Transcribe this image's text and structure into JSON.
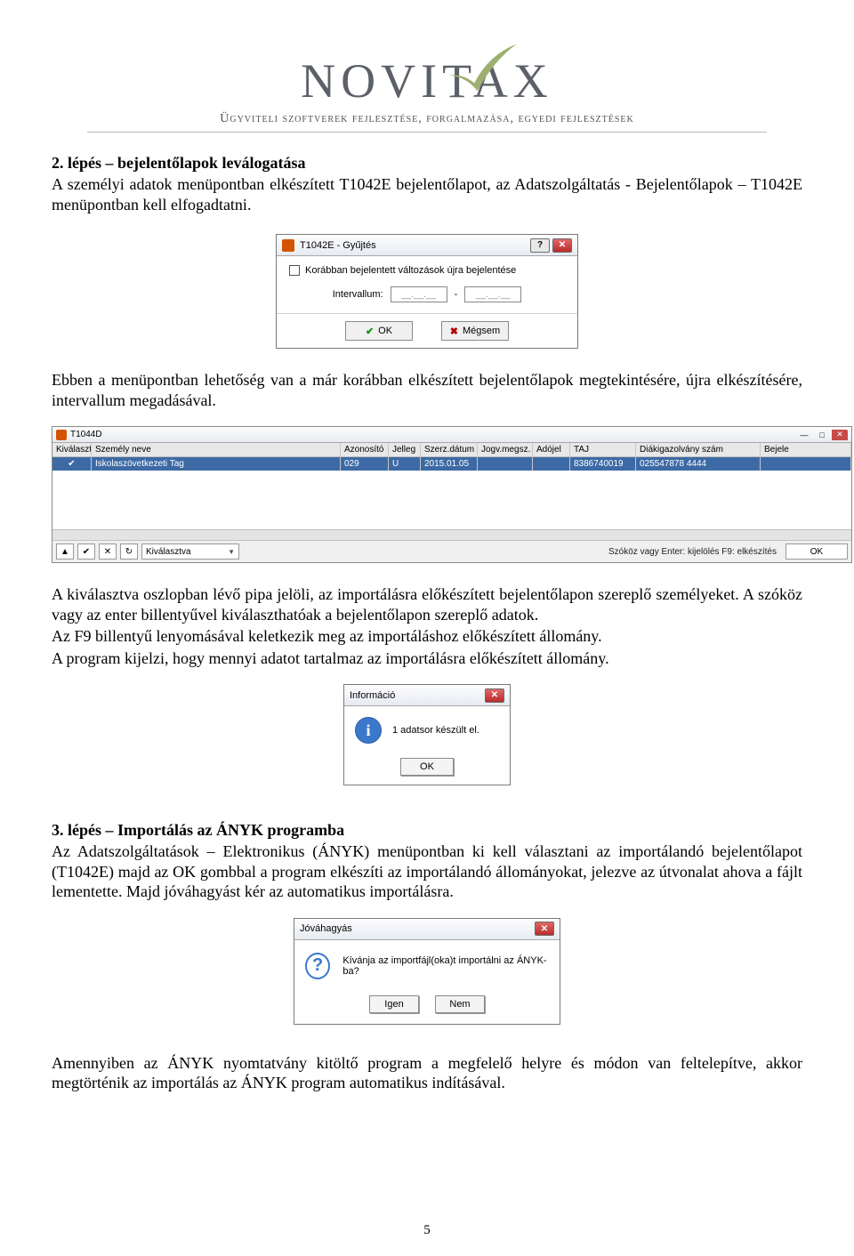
{
  "brand": {
    "name": "NOVITAX",
    "tagline": "Ügyviteli szoftverek fejlesztése, forgalmazása, egyedi fejlesztések"
  },
  "step2": {
    "heading": "2. lépés – bejelentőlapok leválogatása",
    "p1": "A személyi adatok menüpontban elkészített T1042E bejelentőlapot, az Adatszolgáltatás - Bejelentőlapok – T1042E menüpontban kell elfogadtatni.",
    "p2": "Ebben a menüpontban lehetőség van a már korábban elkészített bejelentőlapok megtekintésére, újra elkészítésére, intervallum megadásával.",
    "p3": "A kiválasztva oszlopban lévő pipa jelöli, az importálásra előkészített bejelentőlapon szereplő személyeket. A szóköz vagy az enter billentyűvel kiválaszthatóak a bejelentőlapon szereplő adatok.",
    "p4": "Az F9 billentyű lenyomásával keletkezik meg az importáláshoz előkészített állomány.",
    "p5": "A program kijelzi, hogy mennyi adatot tartalmaz az importálásra előkészített állomány."
  },
  "dlg1": {
    "title": "T1042E - Gyűjtés",
    "checkbox_label": "Korábban bejelentett változások újra bejelentése",
    "interval_label": "Intervallum:",
    "date_placeholder": "__.__.__",
    "ok": "OK",
    "cancel": "Mégsem"
  },
  "table": {
    "title": "T1044D",
    "headers": {
      "kivalasztva": "Kiválasztva",
      "szemely_neve": "Személy neve",
      "azonosito": "Azonosító",
      "jelleg": "Jelleg",
      "szerz_datum": "Szerz.dátum",
      "jogv_megsz": "Jogv.megsz.",
      "adojel": "Adójel",
      "taj": "TAJ",
      "diakigazolvany": "Diákigazolvány szám",
      "bejele": "Bejele"
    },
    "row": {
      "szemely_neve": "Iskolaszövetkezeti Tag",
      "azonosito": "029",
      "jelleg": "U",
      "szerz_datum": "2015.01.05",
      "jogv_megsz": "",
      "adojel": "",
      "taj": "8386740019",
      "diakigazolvany": "025547878  4444",
      "bejele": ""
    },
    "footer": {
      "select_label": "Kiválasztva",
      "hint": "Szóköz vagy Enter: kijelölés   F9: elkészítés",
      "ok": "OK"
    }
  },
  "info_dialog": {
    "title": "Információ",
    "message": "1 adatsor készült el.",
    "ok": "OK"
  },
  "step3": {
    "heading": "3. lépés – Importálás az ÁNYK programba",
    "p1": "Az Adatszolgáltatások – Elektronikus (ÁNYK) menüpontban ki kell választani az importálandó bejelentőlapot (T1042E) majd az OK gombbal a program elkészíti az importálandó állományokat, jelezve az útvonalat ahova a fájlt lementette. Majd jóváhagyást kér az automatikus importálásra."
  },
  "confirm_dialog": {
    "title": "Jóváhagyás",
    "message": "Kívánja az importfájl(oka)t importálni az ÁNYK-ba?",
    "yes": "Igen",
    "no": "Nem"
  },
  "closing": "Amennyiben az ÁNYK nyomtatvány kitöltő program a megfelelő helyre és módon van feltelepítve, akkor megtörténik az importálás az ÁNYK program automatikus indításával.",
  "page_number": "5"
}
